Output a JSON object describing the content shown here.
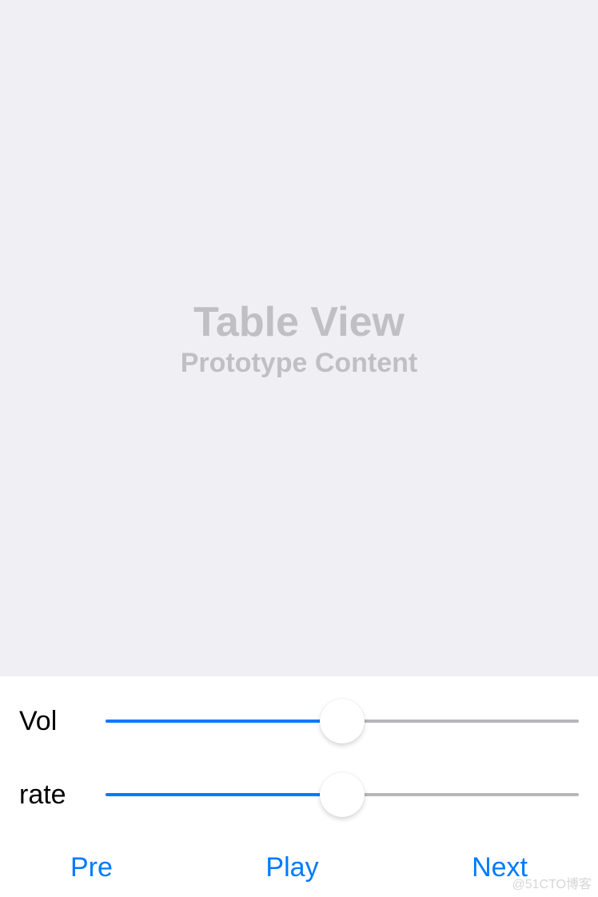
{
  "table": {
    "title": "Table View",
    "subtitle": "Prototype Content"
  },
  "sliders": {
    "vol": {
      "label": "Vol",
      "percent": 50
    },
    "rate": {
      "label": "rate",
      "percent": 50
    }
  },
  "buttons": {
    "pre": "Pre",
    "play": "Play",
    "next": "Next"
  },
  "watermark": "@51CTO博客",
  "colors": {
    "accent": "#007aff",
    "gray_bg": "#efeff4",
    "track": "#b7b7b9"
  }
}
